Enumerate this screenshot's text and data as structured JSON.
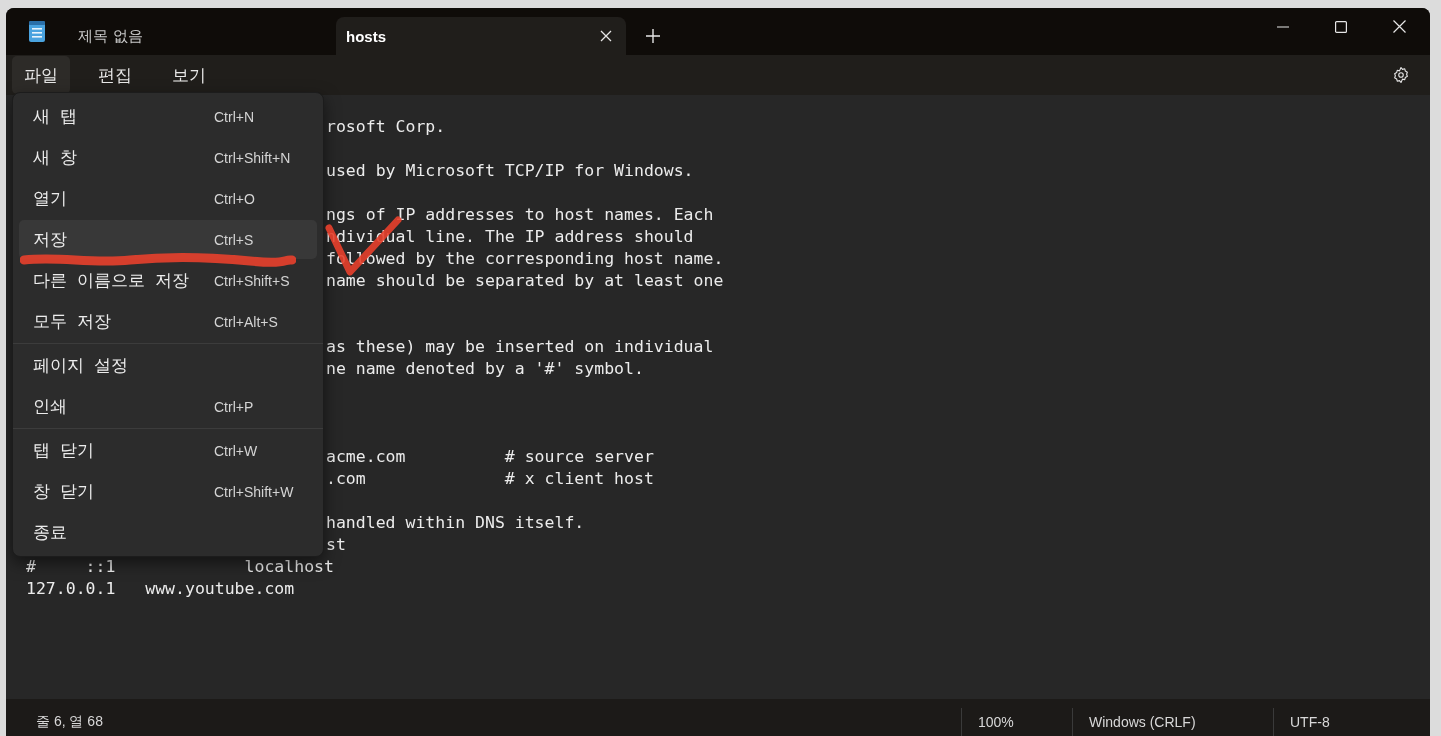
{
  "window": {
    "tabs": [
      {
        "label": "제목 없음",
        "selected": false
      },
      {
        "label": "hosts",
        "selected": true
      }
    ]
  },
  "menu_bar": [
    {
      "label": "파일",
      "selected": true
    },
    {
      "label": "편집",
      "selected": false
    },
    {
      "label": "보기",
      "selected": false
    }
  ],
  "file_menu": [
    {
      "kind": "item",
      "label": "새 탭",
      "shortcut": "Ctrl+N",
      "selected": false
    },
    {
      "kind": "item",
      "label": "새 창",
      "shortcut": "Ctrl+Shift+N",
      "selected": false
    },
    {
      "kind": "item",
      "label": "열기",
      "shortcut": "Ctrl+O",
      "selected": false
    },
    {
      "kind": "item",
      "label": "저장",
      "shortcut": "Ctrl+S",
      "selected": true
    },
    {
      "kind": "item",
      "label": "다른 이름으로 저장",
      "shortcut": "Ctrl+Shift+S",
      "selected": false
    },
    {
      "kind": "item",
      "label": "모두 저장",
      "shortcut": "Ctrl+Alt+S",
      "selected": false
    },
    {
      "kind": "separator"
    },
    {
      "kind": "item",
      "label": "페이지 설정",
      "selected": false
    },
    {
      "kind": "item",
      "label": "인쇄",
      "shortcut": "Ctrl+P",
      "selected": false
    },
    {
      "kind": "separator"
    },
    {
      "kind": "item",
      "label": "탭 닫기",
      "shortcut": "Ctrl+W",
      "selected": false
    },
    {
      "kind": "item",
      "label": "창 닫기",
      "shortcut": "Ctrl+Shift+W",
      "selected": false
    },
    {
      "kind": "item",
      "label": "종료",
      "selected": false
    }
  ],
  "editor": {
    "text_beside_menu": "rosoft Corp.\n\nused by Microsoft TCP/IP for Windows.\n\nngs of IP addresses to host names. Each\nndividual line. The IP address should\nfollowed by the corresponding host name.\nname should be separated by at least one\n\n\nas these) may be inserted on individual\nne name denoted by a '#' symbol.\n\n\n\nacme.com          # source server\n.com              # x client host\n\nhandled within DNS itself.\nst",
    "lines": [
      {
        "text": "#     ::1             localhost"
      },
      {
        "text": "127.0.0.1   www.youtube.com"
      }
    ]
  },
  "markup": {
    "underline": true,
    "checkmark": true
  },
  "status_bar": {
    "position": "줄 6, 열 68",
    "zoom": "100%",
    "line_ending": "Windows (CRLF)",
    "encoding": "UTF-8"
  }
}
